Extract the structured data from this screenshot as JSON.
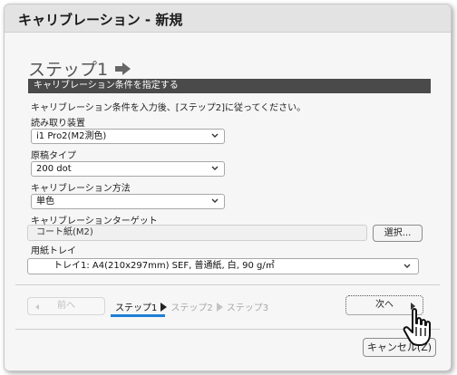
{
  "window": {
    "title": "キャリブレーション - 新規"
  },
  "step_heading": {
    "text": "ステップ1",
    "icon": "right-arrow-icon"
  },
  "section": {
    "title": "キャリブレーション条件を指定する"
  },
  "instruction": "キャリブレーション条件を入力後、[ステップ2]に従ってください。",
  "fields": {
    "reader": {
      "label": "読み取り装置",
      "value": "i1 Pro2(M2測色)"
    },
    "doc_type": {
      "label": "原稿タイプ",
      "value": "200 dot"
    },
    "method": {
      "label": "キャリブレーション方法",
      "value": "単色"
    },
    "target": {
      "label": "キャリブレーションターゲット",
      "value": "コート紙(M2)",
      "button": "選択..."
    },
    "tray": {
      "label": "用紙トレイ",
      "value": "トレイ1: A4(210x297mm) SEF, 普通紙, 白, 90 g/㎡"
    }
  },
  "nav": {
    "prev": "前へ",
    "steps": [
      "ステップ1",
      "ステップ2",
      "ステップ3"
    ],
    "current_step": 1,
    "next": "次へ"
  },
  "cancel": "キャンセル(Z)",
  "colors": {
    "accent": "#1e7fd6",
    "section_bar": "#4a4a4a"
  },
  "icons": {
    "cursor": "hand-pointer-icon"
  }
}
